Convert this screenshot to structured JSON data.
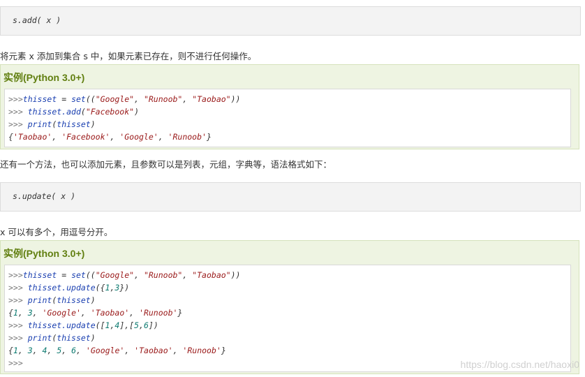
{
  "syntax1": "s.add( x )",
  "para1": "将元素 x 添加到集合 s 中，如果元素已存在，则不进行任何操作。",
  "example1": {
    "title": "实例(Python 3.0+)",
    "lines": [
      ">>>thisset = set((\"Google\", \"Runoob\", \"Taobao\"))",
      ">>> thisset.add(\"Facebook\")",
      ">>> print(thisset)",
      "{'Taobao', 'Facebook', 'Google', 'Runoob'}"
    ]
  },
  "para2": "还有一个方法，也可以添加元素，且参数可以是列表，元组，字典等，语法格式如下：",
  "syntax2": "s.update( x )",
  "para3": "x 可以有多个，用逗号分开。",
  "example2": {
    "title": "实例(Python 3.0+)",
    "lines": [
      ">>>thisset = set((\"Google\", \"Runoob\", \"Taobao\"))",
      ">>> thisset.update({1,3})",
      ">>> print(thisset)",
      "{1, 3, 'Google', 'Taobao', 'Runoob'}",
      ">>> thisset.update([1,4],[5,6])",
      ">>> print(thisset)",
      "{1, 3, 4, 5, 6, 'Google', 'Taobao', 'Runoob'}",
      ">>>"
    ]
  },
  "watermark": "https://blog.csdn.net/haoxi0",
  "colors": {
    "example_bg": "#eef4e2",
    "example_title": "#617f10",
    "keyword": "#1a3fb0",
    "string": "#9a1a1a",
    "number": "#0c7a70"
  }
}
